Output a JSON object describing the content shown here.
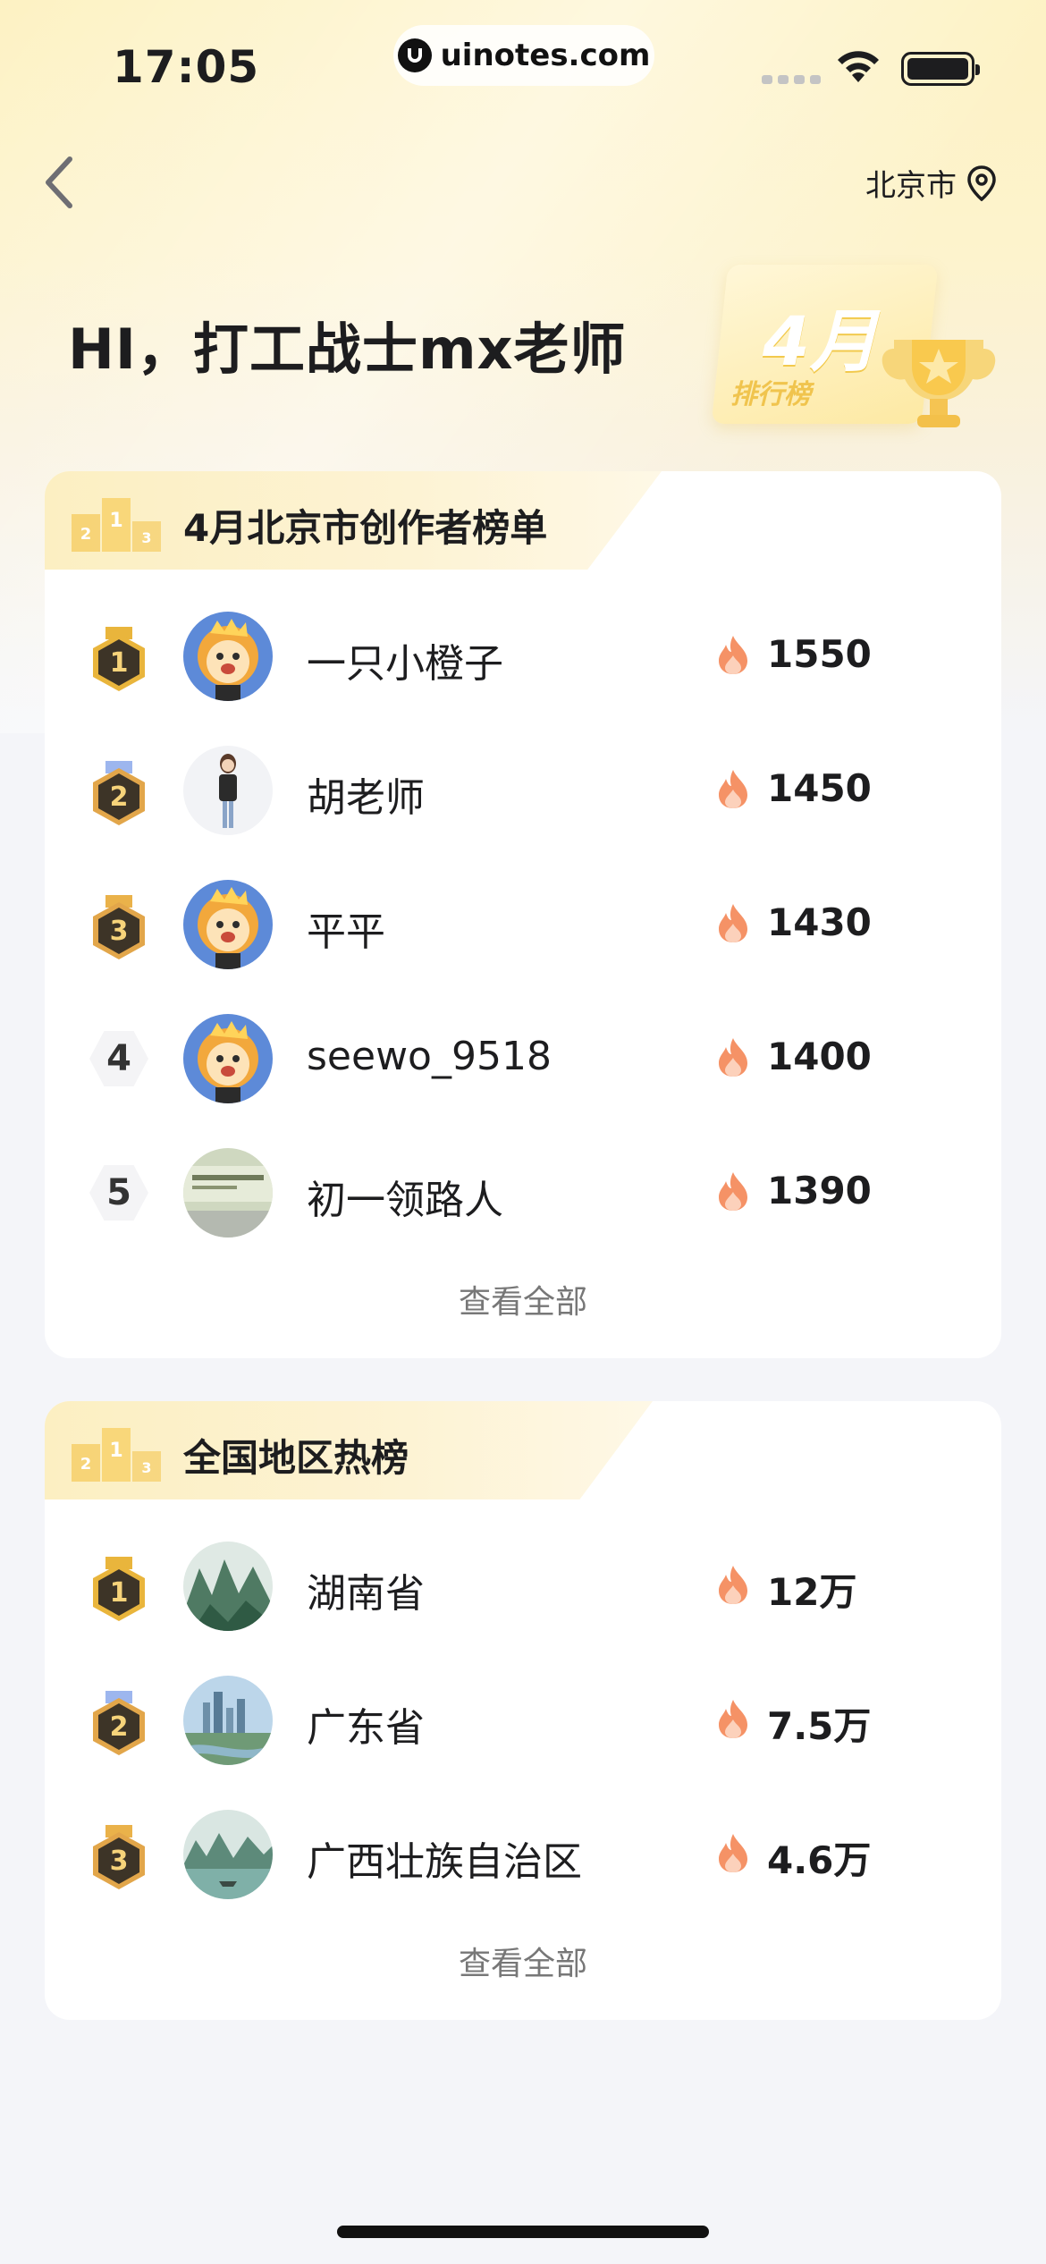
{
  "status_bar": {
    "time": "17:05",
    "url": "uinotes.com"
  },
  "nav": {
    "location": "北京市"
  },
  "greeting": "HI，打工战士mx老师",
  "month_badge": {
    "month": "4月",
    "label": "排行榜"
  },
  "creator_board": {
    "title": "4月北京市创作者榜单",
    "rows": [
      {
        "rank": "1",
        "name": "一只小橙子",
        "score": "1550",
        "avatar": "lion-avatar"
      },
      {
        "rank": "2",
        "name": "胡老师",
        "score": "1450",
        "avatar": "person-avatar"
      },
      {
        "rank": "3",
        "name": "平平",
        "score": "1430",
        "avatar": "lion-avatar"
      },
      {
        "rank": "4",
        "name": "seewo_9518",
        "score": "1400",
        "avatar": "lion-avatar"
      },
      {
        "rank": "5",
        "name": "初一领路人",
        "score": "1390",
        "avatar": "photo-avatar"
      }
    ],
    "view_all": "查看全部"
  },
  "region_board": {
    "title": "全国地区热榜",
    "rows": [
      {
        "rank": "1",
        "name": "湖南省",
        "score": "12万",
        "avatar": "landscape-mountain"
      },
      {
        "rank": "2",
        "name": "广东省",
        "score": "7.5万",
        "avatar": "landscape-city"
      },
      {
        "rank": "3",
        "name": "广西壮族自治区",
        "score": "4.6万",
        "avatar": "landscape-river"
      }
    ],
    "view_all": "查看全部"
  },
  "colors": {
    "gold": "#e9b53c",
    "silver": "#8aa6e8",
    "bronze": "#e8a843",
    "flame": "#f07b4f",
    "header_bg": "#fdf0c4"
  }
}
